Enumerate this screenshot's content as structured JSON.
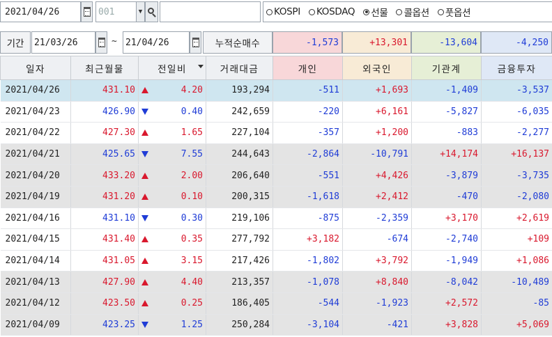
{
  "toolbar": {
    "date": "2021/04/26",
    "code": "001",
    "dropdown_glyph": "▼",
    "name": "",
    "icons": [
      "calendar-icon",
      "chevron-down-icon",
      "search-icon"
    ],
    "market_options": [
      {
        "label": "KOSPI",
        "checked": false
      },
      {
        "label": "KOSDAQ",
        "checked": false
      },
      {
        "label": "선물",
        "checked": true
      },
      {
        "label": "콜옵션",
        "checked": false
      },
      {
        "label": "풋옵션",
        "checked": false
      }
    ]
  },
  "filter": {
    "period_label": "기간",
    "date_from": "21/03/26",
    "tilde": "~",
    "date_to": "21/04/26",
    "cumulative_label": "누적순매수",
    "cumulative": {
      "individual": "-1,573",
      "foreign": "+13,301",
      "institution": "-13,604",
      "financial": "-4,250"
    }
  },
  "table": {
    "headers": {
      "date": "일자",
      "price": "최근월물",
      "change": "전일비",
      "value": "거래대금",
      "individual": "개인",
      "foreign": "외국인",
      "institution": "기관계",
      "financial": "금융투자"
    },
    "rows": [
      {
        "date": "2021/04/26",
        "price": "431.10",
        "dir": "up",
        "change": "4.20",
        "value": "193,294",
        "individual": "-511",
        "foreign": "+1,693",
        "institution": "-1,409",
        "financial": "-3,537",
        "style": "sel"
      },
      {
        "date": "2021/04/23",
        "price": "426.90",
        "dir": "down",
        "change": "0.40",
        "value": "242,659",
        "individual": "-220",
        "foreign": "+6,161",
        "institution": "-5,827",
        "financial": "-6,035",
        "style": ""
      },
      {
        "date": "2021/04/22",
        "price": "427.30",
        "dir": "up",
        "change": "1.65",
        "value": "227,104",
        "individual": "-357",
        "foreign": "+1,200",
        "institution": "-883",
        "financial": "-2,277",
        "style": ""
      },
      {
        "date": "2021/04/21",
        "price": "425.65",
        "dir": "down",
        "change": "7.55",
        "value": "244,643",
        "individual": "-2,864",
        "foreign": "-10,791",
        "institution": "+14,174",
        "financial": "+16,137",
        "style": "gray"
      },
      {
        "date": "2021/04/20",
        "price": "433.20",
        "dir": "up",
        "change": "2.00",
        "value": "206,640",
        "individual": "-551",
        "foreign": "+4,426",
        "institution": "-3,879",
        "financial": "-3,735",
        "style": "gray"
      },
      {
        "date": "2021/04/19",
        "price": "431.20",
        "dir": "up",
        "change": "0.10",
        "value": "200,315",
        "individual": "-1,618",
        "foreign": "+2,412",
        "institution": "-470",
        "financial": "-2,080",
        "style": "gray"
      },
      {
        "date": "2021/04/16",
        "price": "431.10",
        "dir": "down",
        "change": "0.30",
        "value": "219,106",
        "individual": "-875",
        "foreign": "-2,359",
        "institution": "+3,170",
        "financial": "+2,619",
        "style": ""
      },
      {
        "date": "2021/04/15",
        "price": "431.40",
        "dir": "up",
        "change": "0.35",
        "value": "277,792",
        "individual": "+3,182",
        "foreign": "-674",
        "institution": "-2,740",
        "financial": "+109",
        "style": ""
      },
      {
        "date": "2021/04/14",
        "price": "431.05",
        "dir": "up",
        "change": "3.15",
        "value": "217,426",
        "individual": "-1,802",
        "foreign": "+3,792",
        "institution": "-1,949",
        "financial": "+1,086",
        "style": ""
      },
      {
        "date": "2021/04/13",
        "price": "427.90",
        "dir": "up",
        "change": "4.40",
        "value": "213,357",
        "individual": "-1,078",
        "foreign": "+8,840",
        "institution": "-8,042",
        "financial": "-10,489",
        "style": "gray"
      },
      {
        "date": "2021/04/12",
        "price": "423.50",
        "dir": "up",
        "change": "0.25",
        "value": "186,405",
        "individual": "-544",
        "foreign": "-1,923",
        "institution": "+2,572",
        "financial": "-85",
        "style": "gray"
      },
      {
        "date": "2021/04/09",
        "price": "423.25",
        "dir": "down",
        "change": "1.25",
        "value": "250,284",
        "individual": "-3,104",
        "foreign": "-421",
        "institution": "+3,828",
        "financial": "+5,069",
        "style": "gray"
      }
    ]
  },
  "colors": {
    "up": "#d9182d",
    "down": "#1f3cd6",
    "selected_row": "#cfe6f0",
    "alt_row": "#e4e4e4",
    "individual_header": "#f8d7d9",
    "foreign_header": "#f8ebd6",
    "institution_header": "#e6efd6",
    "financial_header": "#dfe8f6"
  }
}
